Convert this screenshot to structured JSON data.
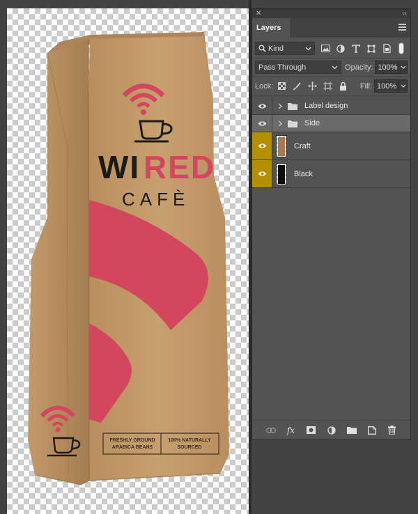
{
  "panel": {
    "title": "Layers",
    "collapse_icon": "double-chevron-left-icon",
    "close_icon": "close-icon",
    "menu_icon": "hamburger-menu-icon"
  },
  "filter": {
    "kind_label": "Kind",
    "icons": [
      "image-filter-icon",
      "adjustment-filter-icon",
      "type-filter-icon",
      "shape-filter-icon",
      "smart-object-filter-icon"
    ]
  },
  "blend": {
    "mode": "Pass Through",
    "opacity_label": "Opacity:",
    "opacity_value": "100%"
  },
  "lock": {
    "label": "Lock:",
    "fill_label": "Fill:",
    "fill_value": "100%"
  },
  "layers": [
    {
      "name": "Label design",
      "type": "group",
      "visible": true,
      "selected": false
    },
    {
      "name": "Side",
      "type": "group",
      "visible": true,
      "selected": true
    },
    {
      "name": "Craft",
      "type": "pixel",
      "visible": true,
      "highlight": "#b48f00",
      "thumb_color": "#a77b4f"
    },
    {
      "name": "Black",
      "type": "pixel",
      "visible": true,
      "highlight": "#b48f00",
      "thumb_color": "#0f0f0f"
    }
  ],
  "footer_icons": [
    "link-layers-icon",
    "fx-icon",
    "mask-icon",
    "adjustment-layer-icon",
    "new-group-icon",
    "new-layer-icon",
    "trash-icon"
  ],
  "artwork": {
    "brand_wi": "WI",
    "brand_red": "RED",
    "brand_sub": "CAFÈ",
    "badge_left_1": "FRESHLY GROUND",
    "badge_left_2": "ARABICA BEANS",
    "badge_right_1": "100% NATURALLY",
    "badge_right_2": "SOURCED",
    "colors": {
      "kraft": "#c39b6c",
      "brand_red": "#d2475e",
      "ink": "#1e1a17"
    }
  }
}
